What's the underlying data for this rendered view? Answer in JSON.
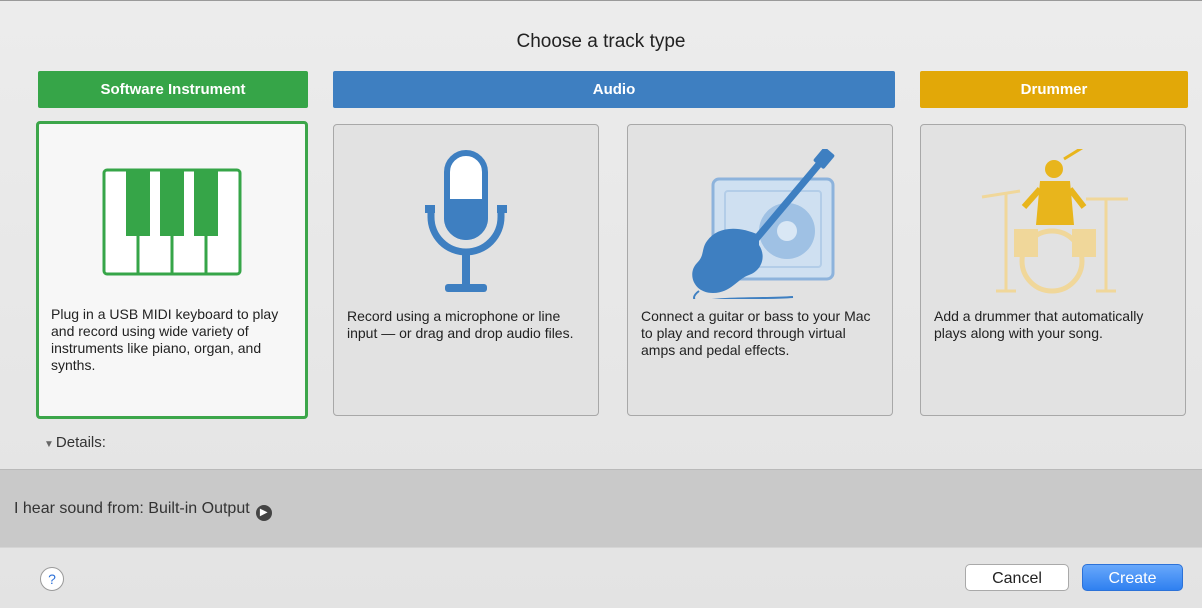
{
  "dialog": {
    "title": "Choose a track type"
  },
  "categories": [
    {
      "label": "Software Instrument",
      "color": "#36a548"
    },
    {
      "label": "Audio",
      "color": "#3e7fc1"
    },
    {
      "label": "Drummer",
      "color": "#e2a808"
    }
  ],
  "cards": [
    {
      "icon": "piano-keyboard-icon",
      "description": "Plug in a USB MIDI keyboard to play and record using wide variety of instruments like piano, organ, and synths.",
      "selected": true
    },
    {
      "icon": "microphone-icon",
      "description": "Record using a microphone or line input — or drag and drop audio files.",
      "selected": false
    },
    {
      "icon": "guitar-amp-icon",
      "description": "Connect a guitar or bass to your Mac to play and record through virtual amps and pedal effects.",
      "selected": false
    },
    {
      "icon": "drummer-icon",
      "description": "Add a drummer that automatically plays along with your song.",
      "selected": false
    }
  ],
  "details": {
    "label": "Details:"
  },
  "output": {
    "label": "I hear sound from: Built-in Output"
  },
  "buttons": {
    "help": "?",
    "cancel": "Cancel",
    "create": "Create"
  },
  "colors": {
    "selection": "#3ca64a",
    "accent": "#2f80f0",
    "microphone": "#3e7fc1",
    "drummer": "#e8b51c"
  }
}
